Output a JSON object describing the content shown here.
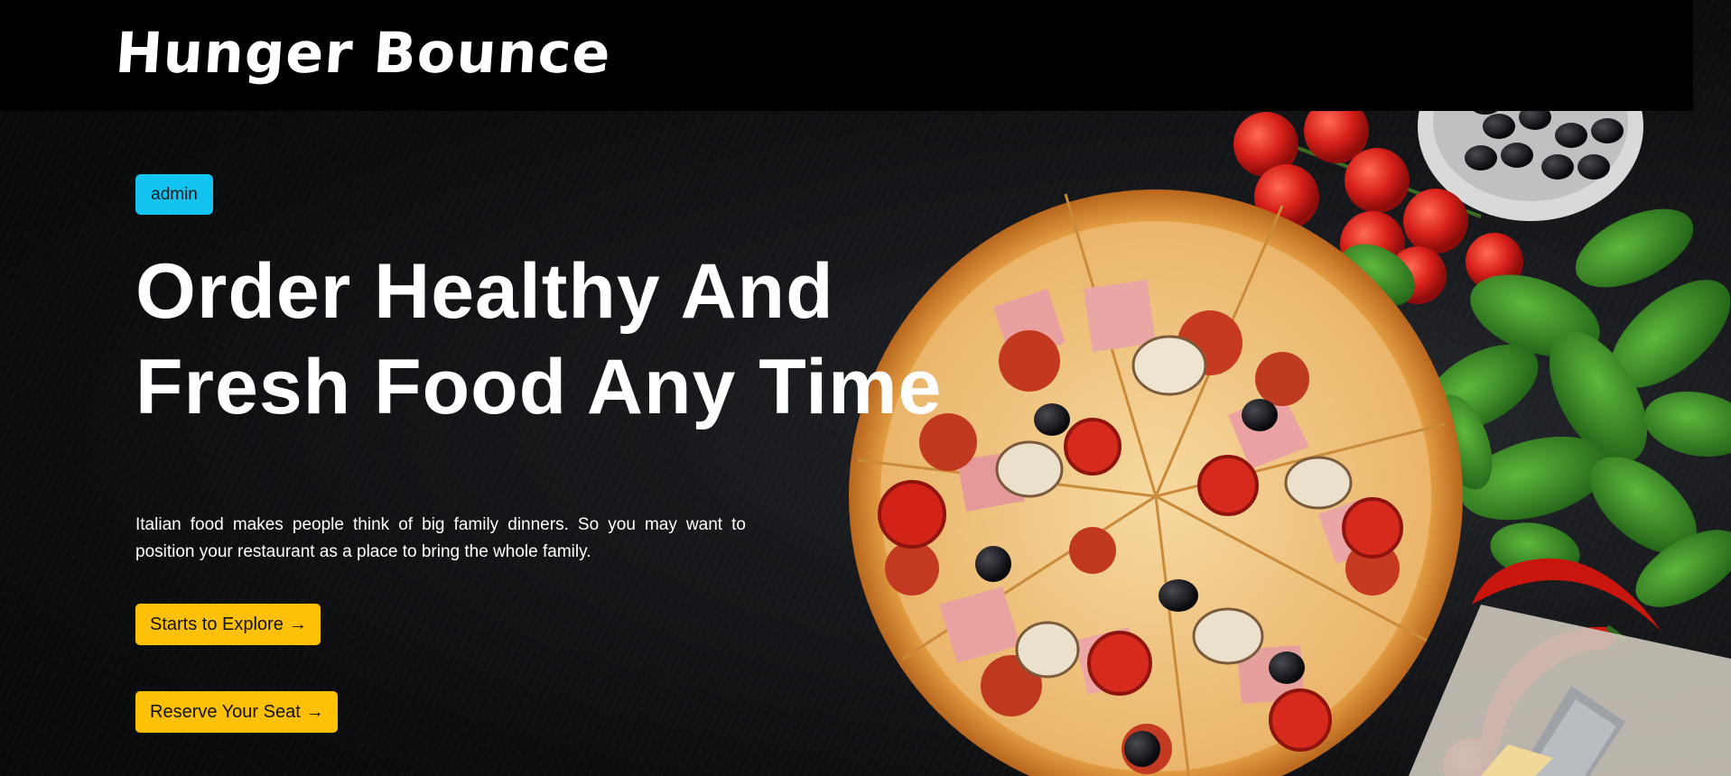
{
  "navbar": {
    "brand": "Hunger Bounce"
  },
  "hero": {
    "badge": "admin",
    "headline": "Order Healthy And Fresh Food Any Time",
    "description": "Italian food makes people think of big family dinners. So you may want to position your restaurant as a place to bring the whole family.",
    "buttons": {
      "explore_label": "Starts to Explore",
      "reserve_label": "Reserve Your Seat",
      "arrow": "→"
    }
  },
  "colors": {
    "badge": "#13c3f0",
    "button": "#ffc107",
    "navbar": "#000000",
    "background": "#0f1113"
  },
  "image": {
    "description_icon": "pizza-hero-image"
  }
}
